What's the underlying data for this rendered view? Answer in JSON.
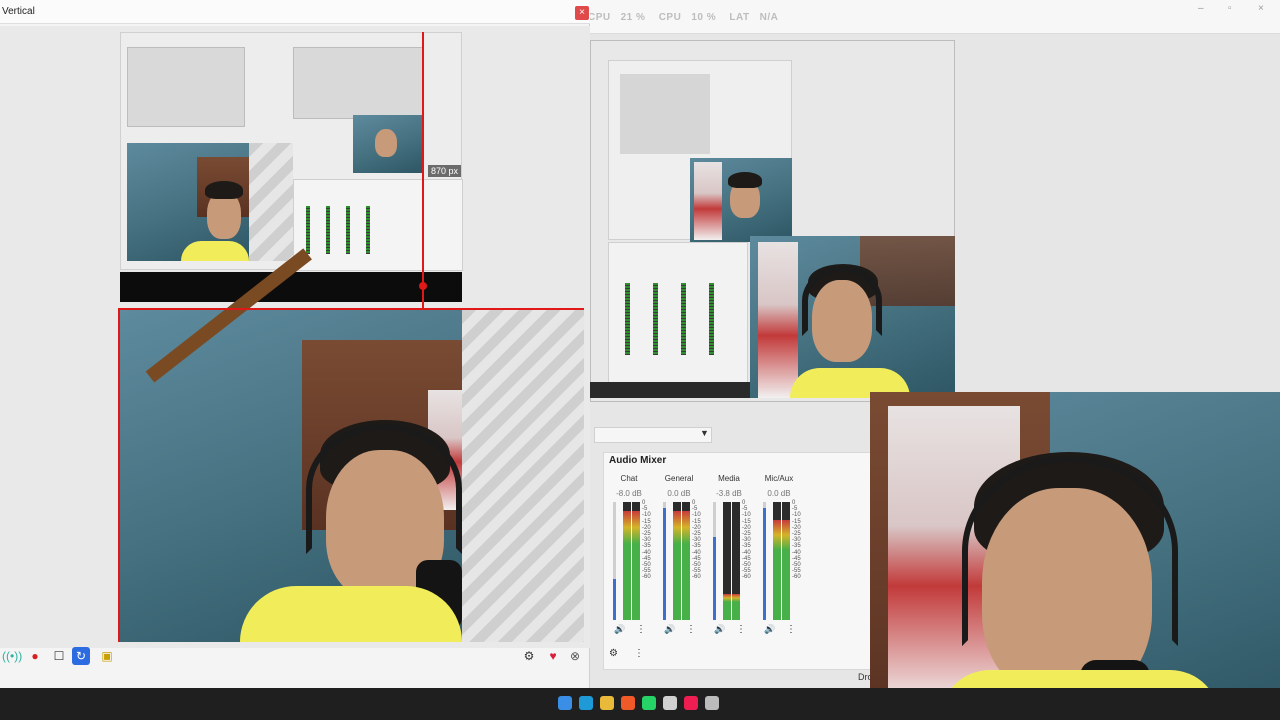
{
  "app": {
    "vertical_window_title": "Vertical",
    "close_glyph": "×"
  },
  "stats": {
    "cpu1_label": "CPU",
    "cpu1_value": "21 %",
    "cpu2_label": "CPU",
    "cpu2_value": "10 %",
    "lat_label": "LAT",
    "lat_value": "N/A"
  },
  "window_controls": {
    "minimize": "–",
    "maximize": "▫",
    "close": "×"
  },
  "preview": {
    "size_readout": "870 px"
  },
  "preview_toolbar": {
    "items": [
      {
        "icon": "broadcast-icon",
        "glyph": "((•))",
        "color": "#2bb3a0"
      },
      {
        "icon": "record-icon",
        "glyph": "●",
        "color": "#d81e1e"
      },
      {
        "icon": "square-icon",
        "glyph": "☐",
        "color": "#333333"
      },
      {
        "icon": "refresh-icon",
        "glyph": "↻",
        "color": "#ffffff"
      },
      {
        "icon": "replay-icon",
        "glyph": "▣",
        "color": "#c9a000"
      }
    ],
    "right_items": [
      {
        "icon": "gear-icon",
        "glyph": "⚙",
        "color": "#333333"
      },
      {
        "icon": "heart-icon",
        "glyph": "♥",
        "color": "#d81e3a"
      },
      {
        "icon": "plugin-icon",
        "glyph": "⊗",
        "color": "#555555"
      }
    ]
  },
  "mixer": {
    "title": "Audio Mixer",
    "channels": [
      {
        "name": "Chat",
        "db": "-8.0 dB",
        "level": 0.92,
        "fader": 0.35
      },
      {
        "name": "General",
        "db": "0.0 dB",
        "level": 0.92,
        "fader": 0.95
      },
      {
        "name": "Media",
        "db": "-3.8 dB",
        "level": 0.22,
        "fader": 0.7
      },
      {
        "name": "Mic/Aux",
        "db": "0.0 dB",
        "level": 0.85,
        "fader": 0.95
      }
    ],
    "scale": [
      "0",
      "-5",
      "-10",
      "-15",
      "-20",
      "-25",
      "-30",
      "-35",
      "-40",
      "-45",
      "-50",
      "-55",
      "-60"
    ],
    "speaker_glyph": "🔊",
    "menu_glyph": "⋮",
    "footer_gear": "⚙",
    "footer_menu": "⋮"
  },
  "status": {
    "truncated_text": "Dro"
  },
  "taskbar": {
    "icons": [
      {
        "name": "windows-start-icon",
        "color": "#3a8ee6"
      },
      {
        "name": "edge-icon",
        "color": "#1e9bd7"
      },
      {
        "name": "file-explorer-icon",
        "color": "#e9b93a"
      },
      {
        "name": "brave-icon",
        "color": "#f05a28"
      },
      {
        "name": "whatsapp-icon",
        "color": "#25d366"
      },
      {
        "name": "obs-icon",
        "color": "#d0d0d0"
      },
      {
        "name": "tiktok-icon",
        "color": "#ee1d52"
      },
      {
        "name": "settings-icon",
        "color": "#bbbbbb"
      }
    ]
  }
}
